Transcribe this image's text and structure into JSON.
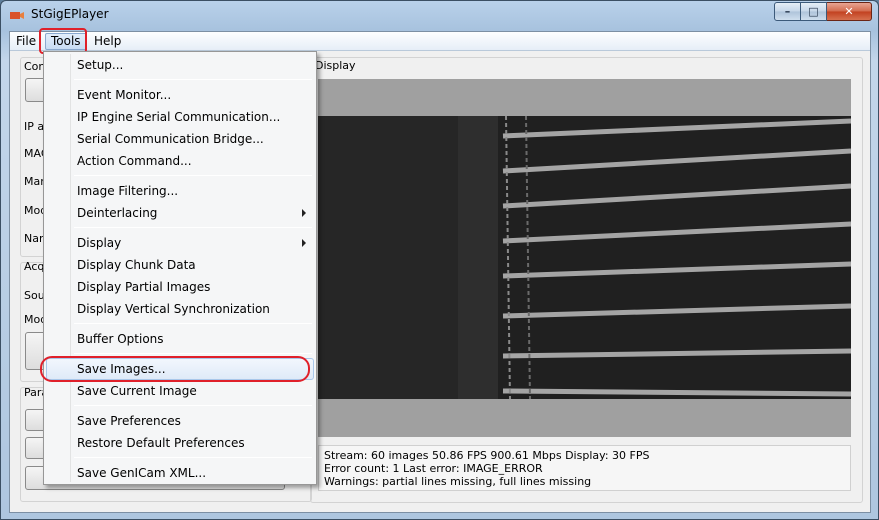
{
  "window": {
    "title": "StGigEPlayer",
    "minimize": "–",
    "maximize": "□",
    "close": "✕"
  },
  "menubar": {
    "file": "File",
    "tools": "Tools",
    "help": "Help"
  },
  "tools_menu": {
    "items": [
      {
        "label": "Setup..."
      },
      {
        "label": "Event Monitor..."
      },
      {
        "label": "IP Engine Serial Communication..."
      },
      {
        "label": "Serial Communication Bridge..."
      },
      {
        "label": "Action Command..."
      },
      {
        "label": "Image Filtering..."
      },
      {
        "label": "Deinterlacing",
        "submenu": true
      },
      {
        "label": "Display",
        "submenu": true
      },
      {
        "label": "Display Chunk Data"
      },
      {
        "label": "Display Partial Images"
      },
      {
        "label": "Display Vertical Synchronization"
      },
      {
        "label": "Buffer Options"
      },
      {
        "label": "Save Images..."
      },
      {
        "label": "Save Current Image"
      },
      {
        "label": "Save Preferences"
      },
      {
        "label": "Restore Default Preferences"
      },
      {
        "label": "Save GenICam XML..."
      }
    ]
  },
  "left_panel": {
    "conn_label": "Con",
    "ip_label": "IP a",
    "mac_label": "MAC",
    "man_label": "Man",
    "mod_label": "Mod",
    "nam_label": "Nam",
    "acq_label": "Acq",
    "sou_label": "Sou",
    "mod2_label": "Mod",
    "para_label": "Para"
  },
  "display": {
    "group_label": "Display",
    "status": {
      "line1": "Stream: 60 images    50.86 FPS    900.61 Mbps      Display: 30 FPS",
      "line2": "Error count: 1    Last error: IMAGE_ERROR",
      "line3": "Warnings: partial lines missing, full lines missing"
    }
  },
  "colors": {
    "highlight_ring": "#e0202a",
    "menu_hover": "#dfeaf8"
  }
}
